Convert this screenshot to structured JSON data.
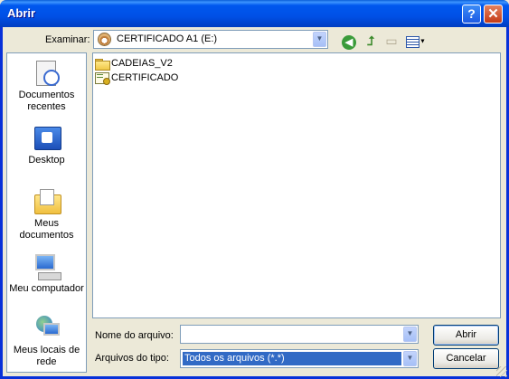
{
  "window": {
    "title": "Abrir"
  },
  "toolbar": {
    "look_in_label": "Examinar:",
    "look_in_value": "CERTIFICADO A1 (E:)"
  },
  "places": [
    {
      "label": "Documentos recentes",
      "icon": "recent-documents-icon"
    },
    {
      "label": "Desktop",
      "icon": "desktop-icon"
    },
    {
      "label": "Meus documentos",
      "icon": "my-documents-icon"
    },
    {
      "label": "Meu computador",
      "icon": "my-computer-icon"
    },
    {
      "label": "Meus locais de rede",
      "icon": "network-places-icon"
    }
  ],
  "files": [
    {
      "name": "CADEIAS_V2",
      "type": "folder"
    },
    {
      "name": "CERTIFICADO",
      "type": "certificate"
    }
  ],
  "form": {
    "filename_label": "Nome do arquivo:",
    "filename_value": "",
    "filetype_label": "Arquivos do tipo:",
    "filetype_value": "Todos os arquivos (*.*)"
  },
  "buttons": {
    "open": "Abrir",
    "cancel": "Cancelar",
    "help": "?",
    "close": "✕"
  },
  "colors": {
    "titlebar": "#0054e3",
    "selection": "#316ac5",
    "dialog_bg": "#ece9d8"
  }
}
